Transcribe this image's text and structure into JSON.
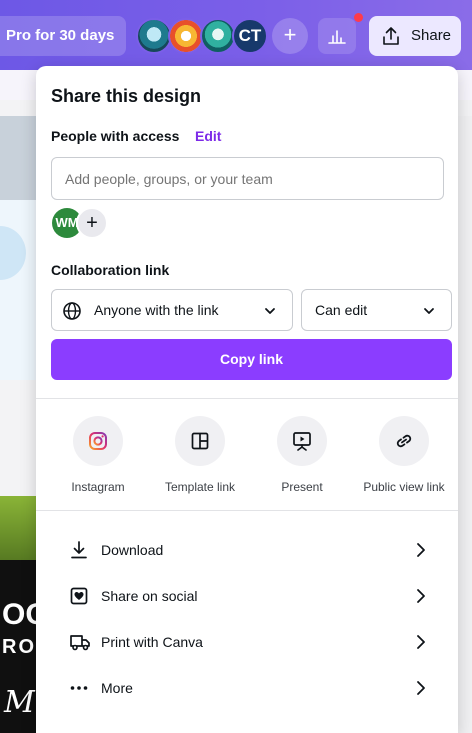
{
  "topbar": {
    "pro_label": "Pro for 30 days",
    "avatar_initials": "CT",
    "add_label": "+",
    "share_label": "Share",
    "accent": "#7b5fe8"
  },
  "background": {
    "canvas_text_1": "OO",
    "canvas_text_2": "RO",
    "canvas_text_3": "M"
  },
  "panel": {
    "title": "Share this design",
    "access": {
      "label": "People with access",
      "edit_label": "Edit",
      "input_placeholder": "Add people, groups, or your team",
      "member_initials": "WM",
      "add_member": "+"
    },
    "collaboration": {
      "label": "Collaboration link",
      "link_scope": "Anyone with the link",
      "permission": "Can edit",
      "copy_label": "Copy link",
      "button_color": "#8b3dff"
    },
    "share_options": [
      {
        "label": "Instagram",
        "icon": "instagram-icon"
      },
      {
        "label": "Template link",
        "icon": "template-icon"
      },
      {
        "label": "Present",
        "icon": "present-icon"
      },
      {
        "label": "Public view link",
        "icon": "link-icon"
      }
    ],
    "menu": [
      {
        "label": "Download",
        "icon": "download-icon"
      },
      {
        "label": "Share on social",
        "icon": "heart-icon"
      },
      {
        "label": "Print with Canva",
        "icon": "truck-icon"
      },
      {
        "label": "More",
        "icon": "more-icon"
      }
    ]
  }
}
